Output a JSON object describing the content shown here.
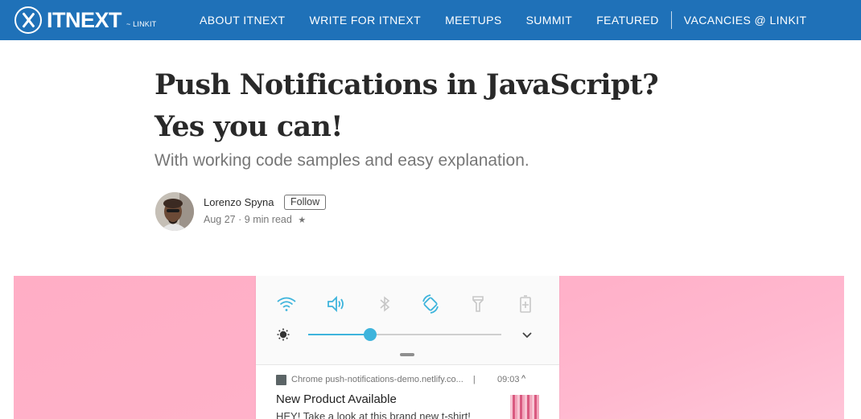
{
  "brand": {
    "name": "ITNEXT",
    "sub": "~ LINKIT",
    "color": "#1f71b8"
  },
  "nav": {
    "items": [
      "ABOUT ITNEXT",
      "WRITE FOR ITNEXT",
      "MEETUPS",
      "SUMMIT",
      "FEATURED"
    ],
    "vacancies": "VACANCIES @ LINKIT"
  },
  "article": {
    "title": "Push Notifications in JavaScript? Yes you can!",
    "subtitle": "With working code samples and easy explanation.",
    "author": "Lorenzo Spyna",
    "follow_label": "Follow",
    "date": "Aug 27",
    "dot": "·",
    "read_time": "9 min read",
    "star": "★"
  },
  "hero": {
    "background_color": "#ffb1c9",
    "quick_settings": [
      "wifi-icon",
      "volume-icon",
      "bluetooth-icon",
      "auto-rotate-icon",
      "flashlight-icon",
      "battery-saver-icon"
    ],
    "accent_color": "#3eb4dc",
    "brightness_level": 0.32,
    "notification": {
      "app": "Chrome",
      "source": "push-notifications-demo.netlify.co...",
      "separator": "|",
      "time": "09:03",
      "caret": "^",
      "title": "New Product Available",
      "text": "HEY! Take a look at this brand new t-shirt!"
    }
  }
}
